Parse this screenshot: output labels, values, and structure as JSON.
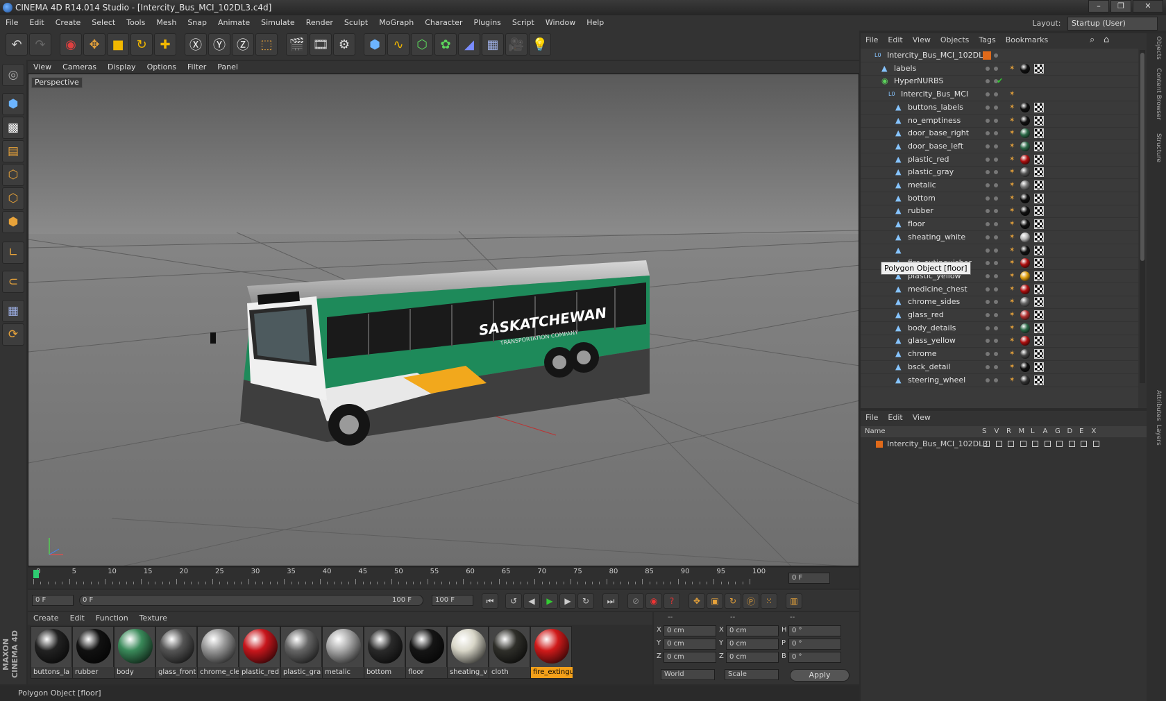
{
  "window": {
    "title": "CINEMA 4D R14.014 Studio - [Intercity_Bus_MCI_102DL3.c4d]"
  },
  "menu": [
    "File",
    "Edit",
    "Create",
    "Select",
    "Tools",
    "Mesh",
    "Snap",
    "Animate",
    "Simulate",
    "Render",
    "Sculpt",
    "MoGraph",
    "Character",
    "Plugins",
    "Script",
    "Window",
    "Help"
  ],
  "layout": {
    "label": "Layout:",
    "value": "Startup (User)"
  },
  "viewport": {
    "menu": [
      "View",
      "Cameras",
      "Display",
      "Options",
      "Filter",
      "Panel"
    ],
    "label": "Perspective"
  },
  "bus": {
    "brand": "SASKATCHEWAN",
    "sub": "TRANSPORTATION COMPANY"
  },
  "timeline": {
    "ticks": [
      "0",
      "5",
      "10",
      "15",
      "20",
      "25",
      "30",
      "35",
      "40",
      "45",
      "50",
      "55",
      "60",
      "65",
      "70",
      "75",
      "80",
      "85",
      "90",
      "95",
      "100"
    ],
    "frame_field": "0 F",
    "start": "0 F",
    "range_start": "0 F",
    "range_end": "100 F",
    "end": "100 F"
  },
  "materials_menu": [
    "Create",
    "Edit",
    "Function",
    "Texture"
  ],
  "materials": [
    {
      "name": "buttons_la",
      "color": "#222"
    },
    {
      "name": "rubber",
      "color": "#111"
    },
    {
      "name": "body",
      "color": "#3a8a5a"
    },
    {
      "name": "glass_front",
      "color": "#555"
    },
    {
      "name": "chrome_cle",
      "color": "#999"
    },
    {
      "name": "plastic_red",
      "color": "#c8161c"
    },
    {
      "name": "plastic_gra",
      "color": "#666"
    },
    {
      "name": "metalic",
      "color": "#aaa"
    },
    {
      "name": "bottom",
      "color": "#2a2a2a"
    },
    {
      "name": "floor",
      "color": "#151515"
    },
    {
      "name": "sheating_v",
      "color": "#d8d6c8"
    },
    {
      "name": "cloth",
      "color": "#2f2f2a"
    },
    {
      "name": "fire_extingu",
      "color": "#d01a1a"
    }
  ],
  "coords": {
    "header": [
      "--",
      "--",
      "--"
    ],
    "rows": [
      {
        "a": "X",
        "av": "0 cm",
        "b": "X",
        "bv": "0 cm",
        "c": "H",
        "cv": "0 °"
      },
      {
        "a": "Y",
        "av": "0 cm",
        "b": "Y",
        "bv": "0 cm",
        "c": "P",
        "cv": "0 °"
      },
      {
        "a": "Z",
        "av": "0 cm",
        "b": "Z",
        "bv": "0 cm",
        "c": "B",
        "cv": "0 °"
      }
    ],
    "mode1": "World",
    "mode2": "Scale",
    "apply": "Apply"
  },
  "status": "Polygon Object [floor]",
  "objects_menu": [
    "File",
    "Edit",
    "View",
    "Objects",
    "Tags",
    "Bookmarks"
  ],
  "objects": [
    {
      "name": "Intercity_Bus_MCI_102DL3",
      "level": 0,
      "type": "null"
    },
    {
      "name": "labels",
      "level": 1,
      "type": "poly"
    },
    {
      "name": "HyperNURBS",
      "level": 1,
      "type": "nurbs"
    },
    {
      "name": "Intercity_Bus_MCI",
      "level": 2,
      "type": "null"
    },
    {
      "name": "buttons_labels",
      "level": 3,
      "type": "poly"
    },
    {
      "name": "no_emptiness",
      "level": 3,
      "type": "poly"
    },
    {
      "name": "door_base_right",
      "level": 3,
      "type": "poly"
    },
    {
      "name": "door_base_left",
      "level": 3,
      "type": "poly"
    },
    {
      "name": "plastic_red",
      "level": 3,
      "type": "poly"
    },
    {
      "name": "plastic_gray",
      "level": 3,
      "type": "poly"
    },
    {
      "name": "metalic",
      "level": 3,
      "type": "poly"
    },
    {
      "name": "bottom",
      "level": 3,
      "type": "poly"
    },
    {
      "name": "rubber",
      "level": 3,
      "type": "poly"
    },
    {
      "name": "floor",
      "level": 3,
      "type": "poly"
    },
    {
      "name": "sheating_white",
      "level": 3,
      "type": "poly"
    },
    {
      "name": "",
      "level": 3,
      "type": "poly"
    },
    {
      "name": "fire_extinguisher",
      "level": 3,
      "type": "poly"
    },
    {
      "name": "plastic_yellow",
      "level": 3,
      "type": "poly"
    },
    {
      "name": "medicine_chest",
      "level": 3,
      "type": "poly"
    },
    {
      "name": "chrome_sides",
      "level": 3,
      "type": "poly"
    },
    {
      "name": "glass_red",
      "level": 3,
      "type": "poly"
    },
    {
      "name": "body_details",
      "level": 3,
      "type": "poly"
    },
    {
      "name": "glass_yellow",
      "level": 3,
      "type": "poly"
    },
    {
      "name": "chrome",
      "level": 3,
      "type": "poly"
    },
    {
      "name": "bsck_detail",
      "level": 3,
      "type": "poly"
    },
    {
      "name": "steering_wheel",
      "level": 3,
      "type": "poly"
    }
  ],
  "tag_colors": [
    "#111",
    "#111",
    "#2e6b4a",
    "#2e6b4a",
    "#b01010",
    "#555",
    "#777",
    "#111",
    "#111",
    "#111",
    "#bbb",
    "#111",
    "#b01010",
    "#e0a010",
    "#b01010",
    "#666",
    "#b03030",
    "#2e6b4a",
    "#b01010",
    "#444",
    "#111",
    "#333"
  ],
  "tooltip": "Polygon Object [floor]",
  "layers_menu": [
    "File",
    "Edit",
    "View"
  ],
  "layers_header": [
    "Name",
    "S",
    "V",
    "R",
    "M",
    "L",
    "A",
    "G",
    "D",
    "E",
    "X"
  ],
  "layer_row": "Intercity_Bus_MCI_102DL3",
  "right_tabs": [
    "Objects",
    "Content Browser",
    "Structure",
    "Attributes",
    "Layers"
  ],
  "brand_side": "MAXON CINEMA 4D"
}
